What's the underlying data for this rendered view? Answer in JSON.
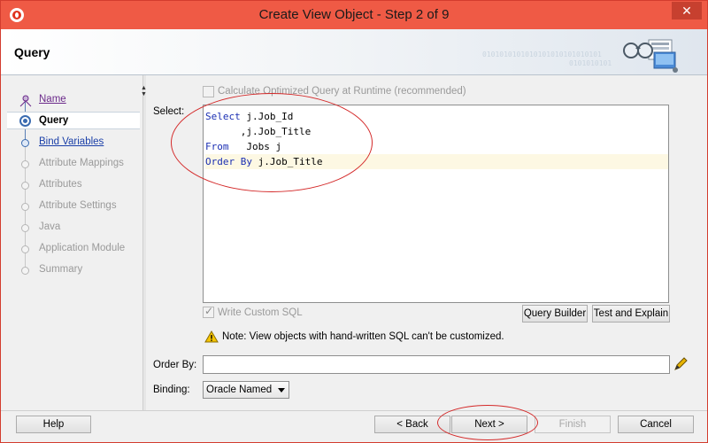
{
  "window": {
    "title": "Create View Object - Step 2 of 9",
    "close_glyph": "✕"
  },
  "header": {
    "title": "Query",
    "binary_line1": "0101010101010101010101010101",
    "binary_line2": "0101010101"
  },
  "nav": {
    "items": [
      {
        "label": "Name",
        "state": "visited"
      },
      {
        "label": "Query",
        "state": "active"
      },
      {
        "label": "Bind Variables",
        "state": "link"
      },
      {
        "label": "Attribute Mappings",
        "state": "disabled"
      },
      {
        "label": "Attributes",
        "state": "disabled"
      },
      {
        "label": "Attribute Settings",
        "state": "disabled"
      },
      {
        "label": "Java",
        "state": "disabled"
      },
      {
        "label": "Application Module",
        "state": "disabled"
      },
      {
        "label": "Summary",
        "state": "disabled"
      }
    ]
  },
  "query": {
    "calc_optimized_label": "Calculate Optimized Query at Runtime (recommended)",
    "select_label": "Select:",
    "sql_lines": [
      {
        "kw": "Select",
        "rest": " j.Job_Id"
      },
      {
        "kw": "",
        "rest": "      ,j.Job_Title"
      },
      {
        "kw": "From",
        "rest": "   Jobs j"
      },
      {
        "kw": "Order By",
        "rest": " j.Job_Title"
      }
    ],
    "write_custom_sql_label": "Write Custom SQL",
    "query_builder_label": "Query Builder",
    "test_explain_label": "Test and Explain",
    "note_text": "Note: View objects with hand-written SQL can't be customized.",
    "order_by_label": "Order By:",
    "order_by_value": "",
    "binding_label": "Binding:",
    "binding_value": "Oracle Named"
  },
  "footer": {
    "help_label": "Help",
    "back_label": "< Back",
    "next_label": "Next >",
    "finish_label": "Finish",
    "cancel_label": "Cancel"
  },
  "colors": {
    "titlebar": "#ef5a45",
    "sql_keyword": "#1b2fb3",
    "annotation": "#d42a2a"
  }
}
